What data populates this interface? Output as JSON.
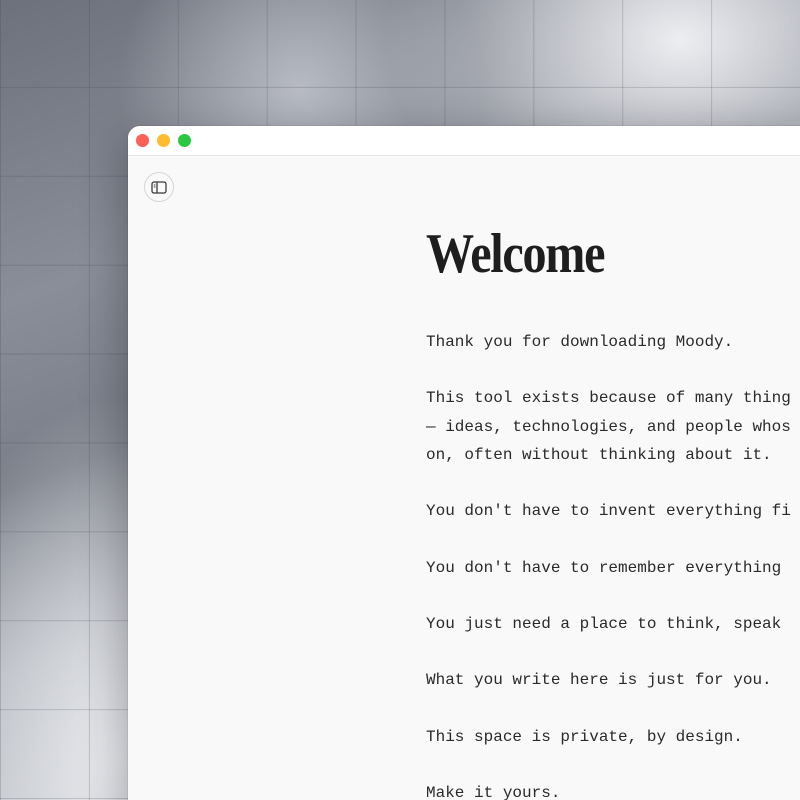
{
  "window": {
    "controls": [
      "close",
      "minimize",
      "zoom"
    ],
    "colors": {
      "close": "#fe5f57",
      "minimize": "#febc2e",
      "zoom": "#28c840"
    }
  },
  "toolbar": {
    "sidebar_toggle_icon": "sidebar-icon"
  },
  "document": {
    "title": "Welcome",
    "paragraphs": [
      "Thank you for downloading Moody.",
      "This tool exists because of many thing",
      "— ideas, technologies, and people whos",
      "on, often without thinking about it.",
      "You don't have to invent everything fi",
      "You don't have to remember everything",
      "You just need a place to think, speak",
      "What you write here is just for you.",
      "This space is private, by design.",
      "Make it yours."
    ]
  }
}
